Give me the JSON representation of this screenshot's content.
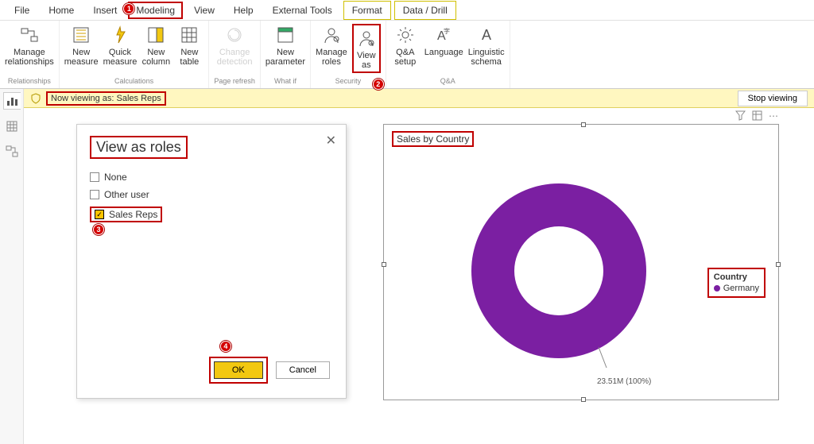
{
  "tabs": {
    "file": "File",
    "home": "Home",
    "insert": "Insert",
    "modeling": "Modeling",
    "view": "View",
    "help": "Help",
    "external": "External Tools",
    "format": "Format",
    "data_drill": "Data / Drill"
  },
  "ribbon": {
    "relationships": {
      "manage": "Manage\nrelationships",
      "label": "Relationships"
    },
    "calc": {
      "new_measure": "New\nmeasure",
      "quick_measure": "Quick\nmeasure",
      "new_column": "New\ncolumn",
      "new_table": "New\ntable",
      "label": "Calculations"
    },
    "page_refresh": {
      "change_detection": "Change\ndetection",
      "label": "Page refresh"
    },
    "whatif": {
      "new_parameter": "New\nparameter",
      "label": "What if"
    },
    "security": {
      "manage_roles": "Manage\nroles",
      "view_as": "View\nas",
      "label": "Security"
    },
    "qa": {
      "qa_setup": "Q&A\nsetup",
      "language": "Language",
      "linguistic": "Linguistic\nschema",
      "label": "Q&A"
    }
  },
  "infobar": {
    "text": "Now viewing as: Sales Reps",
    "stop": "Stop viewing"
  },
  "dialog": {
    "title": "View as roles",
    "close": "✕",
    "roles": {
      "none": "None",
      "other": "Other user",
      "sales": "Sales Reps"
    },
    "ok": "OK",
    "cancel": "Cancel"
  },
  "visual": {
    "title": "Sales by Country",
    "legend_title": "Country",
    "legend_item": "Germany",
    "data_label": "23.51M (100%)"
  },
  "badges": {
    "b1": "1",
    "b2": "2",
    "b3": "3",
    "b4": "4"
  },
  "colors": {
    "accent": "#f2c811",
    "donut": "#7b1fa2",
    "highlight": "#c00000"
  },
  "chart_data": {
    "type": "pie",
    "title": "Sales by Country",
    "categories": [
      "Germany"
    ],
    "values": [
      23.51
    ],
    "unit": "M",
    "percentages": [
      100
    ],
    "series": [
      {
        "name": "Germany",
        "value": 23.51,
        "pct": 100,
        "color": "#7b1fa2"
      }
    ]
  }
}
